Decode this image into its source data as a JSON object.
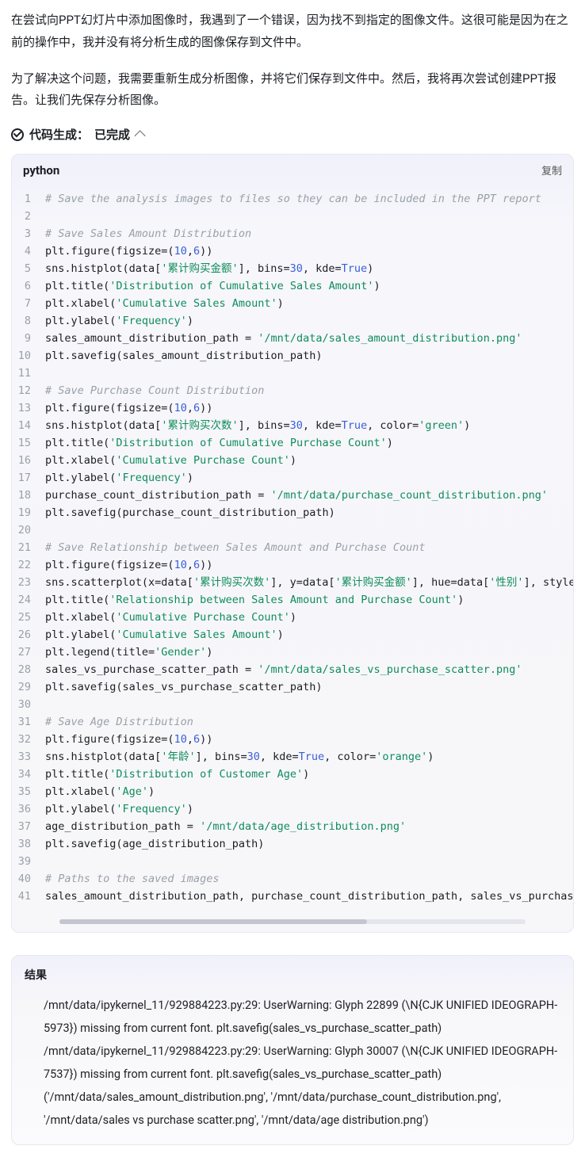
{
  "paragraphs": {
    "p1": "在尝试向PPT幻灯片中添加图像时，我遇到了一个错误，因为找不到指定的图像文件。这很可能是因为在之前的操作中，我并没有将分析生成的图像保存到文件中。",
    "p2": "为了解决这个问题，我需要重新生成分析图像，并将它们保存到文件中。然后，我将再次尝试创建PPT报告。让我们先保存分析图像。"
  },
  "status": {
    "prefix": "代码生成：",
    "state": "已完成"
  },
  "code": {
    "language": "python",
    "copy_label": "复制",
    "lines": [
      {
        "t": "cm",
        "v": "# Save the analysis images to files so they can be included in the PPT report"
      },
      {
        "t": "",
        "v": ""
      },
      {
        "t": "cm",
        "v": "# Save Sales Amount Distribution"
      },
      {
        "t": "c",
        "v": "plt.figure(figsize=(<n>10</n>,<n>6</n>))"
      },
      {
        "t": "c",
        "v": "sns.histplot(data[<s>'累计购买金额'</s>], bins=<n>30</n>, kde=<k>True</k>)"
      },
      {
        "t": "c",
        "v": "plt.title(<s>'Distribution of Cumulative Sales Amount'</s>)"
      },
      {
        "t": "c",
        "v": "plt.xlabel(<s>'Cumulative Sales Amount'</s>)"
      },
      {
        "t": "c",
        "v": "plt.ylabel(<s>'Frequency'</s>)"
      },
      {
        "t": "c",
        "v": "sales_amount_distribution_path = <s>'/mnt/data/sales_amount_distribution.png'</s>"
      },
      {
        "t": "c",
        "v": "plt.savefig(sales_amount_distribution_path)"
      },
      {
        "t": "",
        "v": ""
      },
      {
        "t": "cm",
        "v": "# Save Purchase Count Distribution"
      },
      {
        "t": "c",
        "v": "plt.figure(figsize=(<n>10</n>,<n>6</n>))"
      },
      {
        "t": "c",
        "v": "sns.histplot(data[<s>'累计购买次数'</s>], bins=<n>30</n>, kde=<k>True</k>, color=<s>'green'</s>)"
      },
      {
        "t": "c",
        "v": "plt.title(<s>'Distribution of Cumulative Purchase Count'</s>)"
      },
      {
        "t": "c",
        "v": "plt.xlabel(<s>'Cumulative Purchase Count'</s>)"
      },
      {
        "t": "c",
        "v": "plt.ylabel(<s>'Frequency'</s>)"
      },
      {
        "t": "c",
        "v": "purchase_count_distribution_path = <s>'/mnt/data/purchase_count_distribution.png'</s>"
      },
      {
        "t": "c",
        "v": "plt.savefig(purchase_count_distribution_path)"
      },
      {
        "t": "",
        "v": ""
      },
      {
        "t": "cm",
        "v": "# Save Relationship between Sales Amount and Purchase Count"
      },
      {
        "t": "c",
        "v": "plt.figure(figsize=(<n>10</n>,<n>6</n>))"
      },
      {
        "t": "c",
        "v": "sns.scatterplot(x=data[<s>'累计购买次数'</s>], y=data[<s>'累计购买金额'</s>], hue=data[<s>'性别'</s>], style="
      },
      {
        "t": "c",
        "v": "plt.title(<s>'Relationship between Sales Amount and Purchase Count'</s>)"
      },
      {
        "t": "c",
        "v": "plt.xlabel(<s>'Cumulative Purchase Count'</s>)"
      },
      {
        "t": "c",
        "v": "plt.ylabel(<s>'Cumulative Sales Amount'</s>)"
      },
      {
        "t": "c",
        "v": "plt.legend(title=<s>'Gender'</s>)"
      },
      {
        "t": "c",
        "v": "sales_vs_purchase_scatter_path = <s>'/mnt/data/sales_vs_purchase_scatter.png'</s>"
      },
      {
        "t": "c",
        "v": "plt.savefig(sales_vs_purchase_scatter_path)"
      },
      {
        "t": "",
        "v": ""
      },
      {
        "t": "cm",
        "v": "# Save Age Distribution"
      },
      {
        "t": "c",
        "v": "plt.figure(figsize=(<n>10</n>,<n>6</n>))"
      },
      {
        "t": "c",
        "v": "sns.histplot(data[<s>'年龄'</s>], bins=<n>30</n>, kde=<k>True</k>, color=<s>'orange'</s>)"
      },
      {
        "t": "c",
        "v": "plt.title(<s>'Distribution of Customer Age'</s>)"
      },
      {
        "t": "c",
        "v": "plt.xlabel(<s>'Age'</s>)"
      },
      {
        "t": "c",
        "v": "plt.ylabel(<s>'Frequency'</s>)"
      },
      {
        "t": "c",
        "v": "age_distribution_path = <s>'/mnt/data/age_distribution.png'</s>"
      },
      {
        "t": "c",
        "v": "plt.savefig(age_distribution_path)"
      },
      {
        "t": "",
        "v": ""
      },
      {
        "t": "cm",
        "v": "# Paths to the saved images"
      },
      {
        "t": "c",
        "v": "sales_amount_distribution_path, purchase_count_distribution_path, sales_vs_purchase_s"
      }
    ]
  },
  "result": {
    "title": "结果",
    "lines": [
      "/mnt/data/ipykernel_11/929884223.py:29: UserWarning: Glyph 22899 (\\N{CJK UNIFIED IDEOGRAPH-5973}) missing from current font. plt.savefig(sales_vs_purchase_scatter_path)",
      "/mnt/data/ipykernel_11/929884223.py:29: UserWarning: Glyph 30007 (\\N{CJK UNIFIED IDEOGRAPH-7537}) missing from current font. plt.savefig(sales_vs_purchase_scatter_path)",
      "('/mnt/data/sales_amount_distribution.png', '/mnt/data/purchase_count_distribution.png', '/mnt/data/sales vs purchase scatter.png', '/mnt/data/age distribution.png')"
    ]
  }
}
